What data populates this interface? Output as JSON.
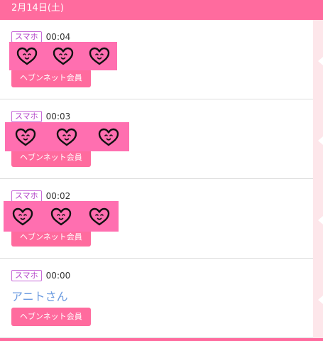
{
  "header": {
    "date": "2月14日(土)"
  },
  "entries": [
    {
      "device": "スマホ",
      "time": "00:04",
      "name": "",
      "member": "ヘブンネット会員",
      "name_redacted": true
    },
    {
      "device": "スマホ",
      "time": "00:03",
      "name": "",
      "member": "ヘブンネット会員",
      "name_redacted": true
    },
    {
      "device": "スマホ",
      "time": "00:02",
      "name": "",
      "member": "ヘブンネット会員",
      "name_redacted": true
    },
    {
      "device": "スマホ",
      "time": "00:00",
      "name": "アニトさん",
      "member": "ヘブンネット会員",
      "name_redacted": false
    }
  ],
  "colors": {
    "accent": "#ff6b9e",
    "redaction": "#ff6fb0",
    "device_badge": "#b445c9",
    "name": "#6b9be0",
    "side_strip": "#fde6ea"
  },
  "icons": {
    "redaction": "heart-face-icon"
  }
}
